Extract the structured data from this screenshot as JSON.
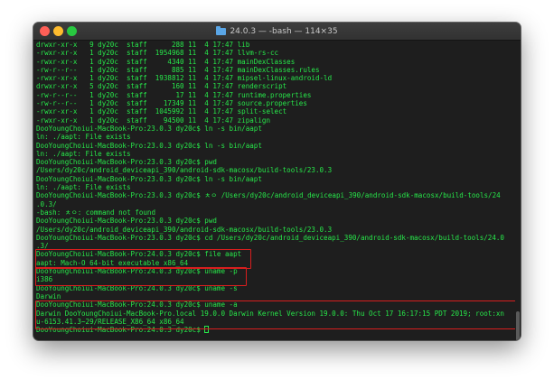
{
  "window": {
    "title": "24.0.3 — -bash — 114×35",
    "title_icon": "folder-icon",
    "text_color": "#27e84a",
    "background": "#1e1e1e",
    "highlight_color": "#d81e1e"
  },
  "terminal": {
    "lines": [
      "drwxr-xr-x   9 dy20c  staff      288 11  4 17:47 lib",
      "-rwxr-xr-x   1 dy20c  staff  1954968 11  4 17:47 llvm-rs-cc",
      "-rwxr-xr-x   1 dy20c  staff     4340 11  4 17:47 mainDexClasses",
      "-rw-r--r--   1 dy20c  staff      885 11  4 17:47 mainDexClasses.rules",
      "-rwxr-xr-x   1 dy20c  staff  1938812 11  4 17:47 mipsel-linux-android-ld",
      "drwxr-xr-x   5 dy20c  staff      160 11  4 17:47 renderscript",
      "-rw-r--r--   1 dy20c  staff       17 11  4 17:47 runtime.properties",
      "-rw-r--r--   1 dy20c  staff    17349 11  4 17:47 source.properties",
      "-rwxr-xr-x   1 dy20c  staff  1045992 11  4 17:47 split-select",
      "-rwxr-xr-x   1 dy20c  staff    94500 11  4 17:47 zipalign",
      "DooYoungChoiui-MacBook-Pro:23.0.3 dy20c$ ln -s bin/aapt",
      "ln: ./aapt: File exists",
      "DooYoungChoiui-MacBook-Pro:23.0.3 dy20c$ ln -s bin/aapt",
      "ln: ./aapt: File exists",
      "DooYoungChoiui-MacBook-Pro:23.0.3 dy20c$ pwd",
      "/Users/dy20c/android_deviceapi_390/android-sdk-macosx/build-tools/23.0.3",
      "DooYoungChoiui-MacBook-Pro:23.0.3 dy20c$ ln -s bin/aapt",
      "ln: ./aapt: File exists",
      "DooYoungChoiui-MacBook-Pro:23.0.3 dy20c$ ㅊㅇ /Users/dy20c/android_deviceapi_390/android-sdk-macosx/build-tools/24",
      ".0.3/",
      "-bash: ㅊㅇ: command not found",
      "DooYoungChoiui-MacBook-Pro:23.0.3 dy20c$ pwd",
      "/Users/dy20c/android_deviceapi_390/android-sdk-macosx/build-tools/23.0.3",
      "DooYoungChoiui-MacBook-Pro:23.0.3 dy20c$ cd /Users/dy20c/android_deviceapi_390/android-sdk-macosx/build-tools/24.0",
      ".3/",
      "DooYoungChoiui-MacBook-Pro:24.0.3 dy20c$ file aapt",
      "aapt: Mach-O 64-bit executable x86_64",
      "DooYoungChoiui-MacBook-Pro:24.0.3 dy20c$ uname -p",
      "i386",
      "DooYoungChoiui-MacBook-Pro:24.0.3 dy20c$ uname -s",
      "Darwin",
      "DooYoungChoiui-MacBook-Pro:24.0.3 dy20c$ uname -a",
      "Darwin DooYoungChoiui-MacBook-Pro.local 19.0.0 Darwin Kernel Version 19.0.0: Thu Oct 17 16:17:15 PDT 2019; root:xn",
      "u-6153.41.3~29/RELEASE_X86_64 x86_64",
      "DooYoungChoiui-MacBook-Pro:24.0.3 dy20c$ "
    ]
  }
}
